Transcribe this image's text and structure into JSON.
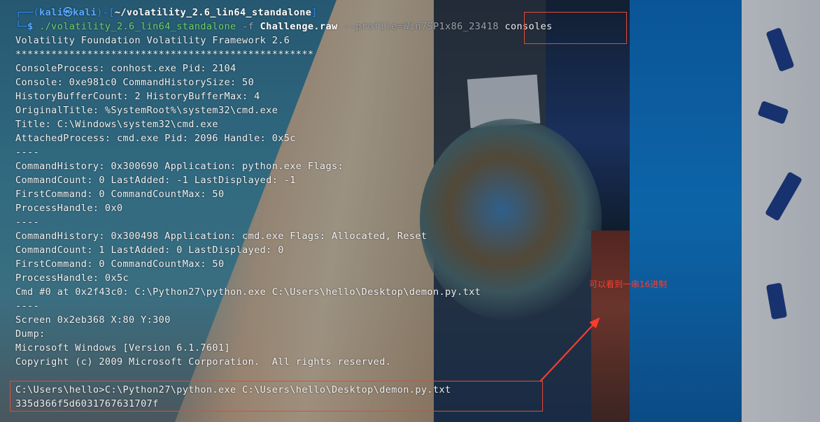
{
  "terminal": {
    "prompt_user": "kali",
    "prompt_host": "kali",
    "prompt_path": "~/volatility_2.6_lin64_standalone",
    "command": {
      "exec": "./volatility_2.6_lin64_standalone",
      "flag_f": "-f",
      "file": "Challenge.raw",
      "profile": "--profile=Win7SP1x86_23418",
      "plugin": "consoles"
    },
    "lines": [
      "Volatility Foundation Volatility Framework 2.6",
      "**************************************************",
      "ConsoleProcess: conhost.exe Pid: 2104",
      "Console: 0xe981c0 CommandHistorySize: 50",
      "HistoryBufferCount: 2 HistoryBufferMax: 4",
      "OriginalTitle: %SystemRoot%\\system32\\cmd.exe",
      "Title: C:\\Windows\\system32\\cmd.exe",
      "AttachedProcess: cmd.exe Pid: 2096 Handle: 0x5c",
      "----",
      "CommandHistory: 0x300690 Application: python.exe Flags:",
      "CommandCount: 0 LastAdded: -1 LastDisplayed: -1",
      "FirstCommand: 0 CommandCountMax: 50",
      "ProcessHandle: 0x0",
      "----",
      "CommandHistory: 0x300498 Application: cmd.exe Flags: Allocated, Reset",
      "CommandCount: 1 LastAdded: 0 LastDisplayed: 0",
      "FirstCommand: 0 CommandCountMax: 50",
      "ProcessHandle: 0x5c",
      "Cmd #0 at 0x2f43c0: C:\\Python27\\python.exe C:\\Users\\hello\\Desktop\\demon.py.txt",
      "----",
      "Screen 0x2eb368 X:80 Y:300",
      "Dump:",
      "Microsoft Windows [Version 6.1.7601]",
      "Copyright (c) 2009 Microsoft Corporation.  All rights reserved.",
      "",
      "C:\\Users\\hello>C:\\Python27\\python.exe C:\\Users\\hello\\Desktop\\demon.py.txt",
      "335d366f5d6031767631707f"
    ]
  },
  "annotation": {
    "text": "可以看到一串16进制",
    "color": "#ff3b30"
  }
}
